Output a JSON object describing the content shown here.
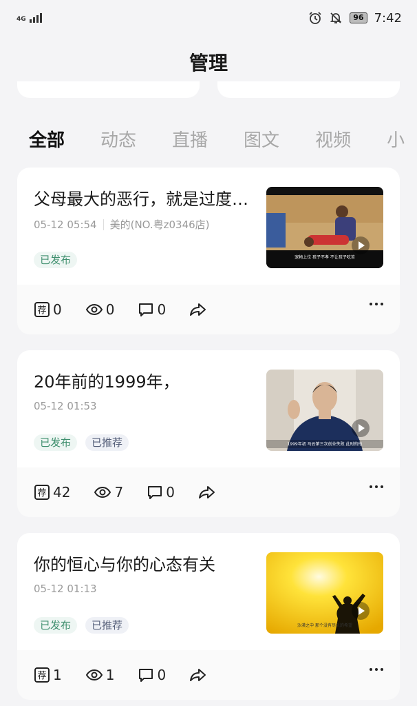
{
  "status_bar": {
    "network": "4G",
    "battery": "96",
    "time": "7:42"
  },
  "header": {
    "title": "管理"
  },
  "tabs": [
    {
      "label": "全部"
    },
    {
      "label": "动态"
    },
    {
      "label": "直播"
    },
    {
      "label": "图文"
    },
    {
      "label": "视频"
    },
    {
      "label": "小"
    }
  ],
  "posts": [
    {
      "title": "父母最大的恶行，就是过度…",
      "date": "05-12 05:54",
      "store": "美的(NO.粤z0346店)",
      "badges": [
        "已发布"
      ],
      "thumb_caption": "宠物上位 孩子不孝 不让孩子吃苦",
      "stats": {
        "recommend": "0",
        "views": "0",
        "comments": "0"
      }
    },
    {
      "title": "20年前的1999年，",
      "date": "05-12 01:53",
      "store": "",
      "badges": [
        "已发布",
        "已推荐"
      ],
      "thumb_caption": "1999年初 马云第三次创业失败 此时的他",
      "stats": {
        "recommend": "42",
        "views": "7",
        "comments": "0"
      }
    },
    {
      "title": "你的恒心与你的心态有关",
      "date": "05-12 01:13",
      "store": "",
      "badges": [
        "已发布",
        "已推荐"
      ],
      "thumb_caption": "沙漠之中 那个没有尽头的希望",
      "stats": {
        "recommend": "1",
        "views": "1",
        "comments": "0"
      }
    }
  ],
  "icons": {
    "recommend": "recommend-icon",
    "view": "eye-icon",
    "comment": "comment-icon",
    "share": "share-icon",
    "more": "more-icon",
    "play": "play-icon"
  },
  "colors": {
    "background": "#f4f4f6",
    "badge_green_text": "#3f8f6e",
    "badge_blue_text": "#56607a"
  }
}
